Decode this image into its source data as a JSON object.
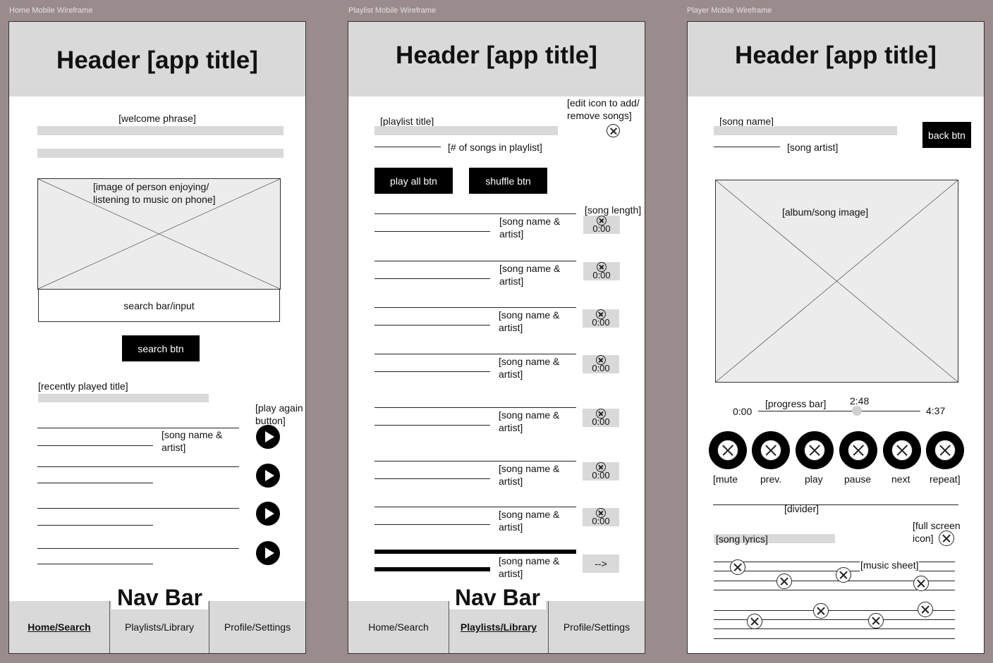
{
  "frames": {
    "home": {
      "label": "Home Mobile Wireframe",
      "header": "Header [app title]",
      "welcome": "[welcome phrase]",
      "image_caption": "[image of person enjoying/ listening to music on phone]",
      "search_input": "search bar/input",
      "search_btn": "search btn",
      "recent_title": "[recently played title]",
      "play_again": "[play again button]",
      "song_label": "[song name & artist]",
      "nav_title": "Nav Bar",
      "nav": [
        "Home/Search",
        "Playlists/Library",
        "Profile/Settings"
      ]
    },
    "playlist": {
      "label": "Playlist Mobile Wireframe",
      "header": "Header [app title]",
      "playlist_title": "[playlist title]",
      "edit_icon": "[edit icon to add/ remove songs]",
      "song_count": "[# of songs in playlist]",
      "play_all": "play all btn",
      "shuffle": "shuffle btn",
      "song_length": "[song length]",
      "song_label": "[song name & artist]",
      "time": "0:00",
      "more": "-->",
      "nav_title": "Nav Bar",
      "nav": [
        "Home/Search",
        "Playlists/Library",
        "Profile/Settings"
      ]
    },
    "player": {
      "label": "Player Mobile Wireframe",
      "header": "Header [app title]",
      "song_name": "[song name]",
      "song_artist": "[song artist]",
      "back_btn": "back btn",
      "album_image": "[album/song image]",
      "progress_label": "[progress bar]",
      "time_start": "0:00",
      "time_current": "2:48",
      "time_end": "4:37",
      "progress": 0.61,
      "controls": [
        "[mute",
        "prev.",
        "play",
        "pause",
        "next",
        "repeat]"
      ],
      "divider": "[divider]",
      "lyrics": "[song lyrics]",
      "fullscreen": "[full screen icon]",
      "music_sheet": "[music sheet]"
    }
  }
}
